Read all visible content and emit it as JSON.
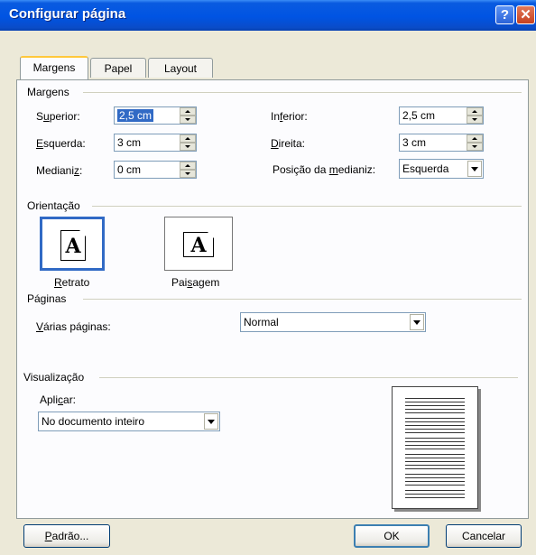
{
  "window": {
    "title": "Configurar página",
    "help_icon": "question-icon",
    "close_icon": "close-icon"
  },
  "tabs": [
    {
      "label": "Margens",
      "active": true
    },
    {
      "label": "Papel",
      "active": false
    },
    {
      "label": "Layout",
      "active": false
    }
  ],
  "margins": {
    "group_label": "Margens",
    "top": {
      "label_pre": "S",
      "label_ul": "u",
      "label_post": "perior:",
      "value": "2,5 cm"
    },
    "bottom": {
      "label_pre": "In",
      "label_ul": "f",
      "label_post": "erior:",
      "value": "2,5 cm"
    },
    "left": {
      "label_pre": "",
      "label_ul": "E",
      "label_post": "squerda:",
      "value": "3 cm"
    },
    "right": {
      "label_pre": "",
      "label_ul": "D",
      "label_post": "ireita:",
      "value": "3 cm"
    },
    "gutter": {
      "label_pre": "Mediani",
      "label_ul": "z",
      "label_post": ":",
      "value": "0 cm"
    },
    "gutter_position": {
      "label_pre": "Posição da ",
      "label_ul": "m",
      "label_post": "edianiz:",
      "value": "Esquerda"
    }
  },
  "orientation": {
    "group_label": "Orientação",
    "portrait": {
      "label_pre": "",
      "label_ul": "R",
      "label_post": "etrato",
      "glyph": "A"
    },
    "landscape": {
      "label_pre": "Pai",
      "label_ul": "s",
      "label_post": "agem",
      "glyph": "A"
    }
  },
  "pages": {
    "group_label": "Páginas",
    "multiple": {
      "label_pre": "",
      "label_ul": "V",
      "label_post": "árias páginas:",
      "value": "Normal"
    }
  },
  "preview": {
    "group_label": "Visualização",
    "apply": {
      "label_pre": "Apli",
      "label_ul": "c",
      "label_post": "ar:",
      "value": "No documento inteiro"
    }
  },
  "buttons": {
    "default": {
      "label_pre": "",
      "label_ul": "P",
      "label_post": "adrão..."
    },
    "ok": "OK",
    "cancel": "Cancelar"
  },
  "colors": {
    "titlebar": "#0054E3",
    "selection": "#316AC5",
    "face": "#ECE9D8",
    "default_border": "#3C7FB1"
  }
}
